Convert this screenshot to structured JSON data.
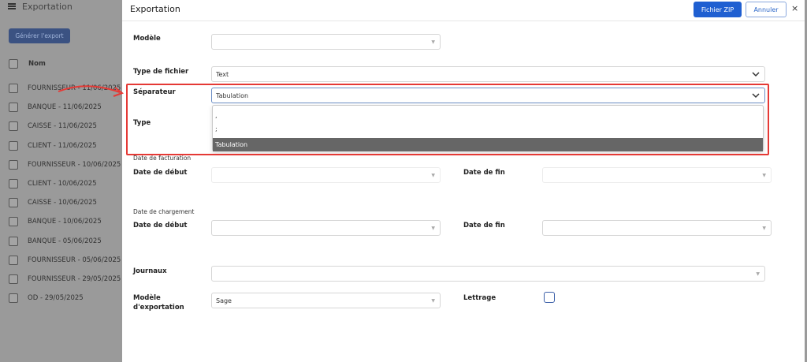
{
  "background": {
    "app_title": "Exportation",
    "generate_button": "Générer l'export",
    "column_header": "Nom",
    "rows": [
      "FOURNISSEUR - 11/06/2025",
      "BANQUE - 11/06/2025",
      "CAISSE - 11/06/2025",
      "CLIENT - 11/06/2025",
      "FOURNISSEUR - 10/06/2025",
      "CLIENT - 10/06/2025",
      "CAISSE - 10/06/2025",
      "BANQUE - 10/06/2025",
      "BANQUE - 05/06/2025",
      "FOURNISSEUR - 05/06/2025",
      "FOURNISSEUR - 29/05/2025",
      "OD - 29/05/2025"
    ]
  },
  "modal": {
    "title": "Exportation",
    "zip_button": "Fichier ZIP",
    "cancel_button": "Annuler",
    "close_icon": "×",
    "labels": {
      "modele": "Modèle",
      "type_fichier": "Type de fichier",
      "separateur": "Séparateur",
      "type": "Type",
      "date_facturation": "Date de facturation",
      "date_debut_1": "Date de début",
      "date_fin_1": "Date de fin",
      "date_chargement": "Date de chargement",
      "date_debut_2": "Date de début",
      "date_fin_2": "Date de fin",
      "journaux": "Journaux",
      "modele_exportation_line1": "Modèle",
      "modele_exportation_line2": "d'exportation",
      "lettrage": "Lettrage"
    },
    "values": {
      "modele": "",
      "type_fichier": "Text",
      "separateur": "Tabulation",
      "modele_exportation": "Sage"
    },
    "separator_options": [
      ",",
      ";",
      "Tabulation"
    ],
    "selected_option": "Tabulation",
    "lettrage_checked": false
  },
  "colors": {
    "primary": "#1f5fd1",
    "highlight": "#e53935",
    "overlay": "#9a9a9a"
  }
}
